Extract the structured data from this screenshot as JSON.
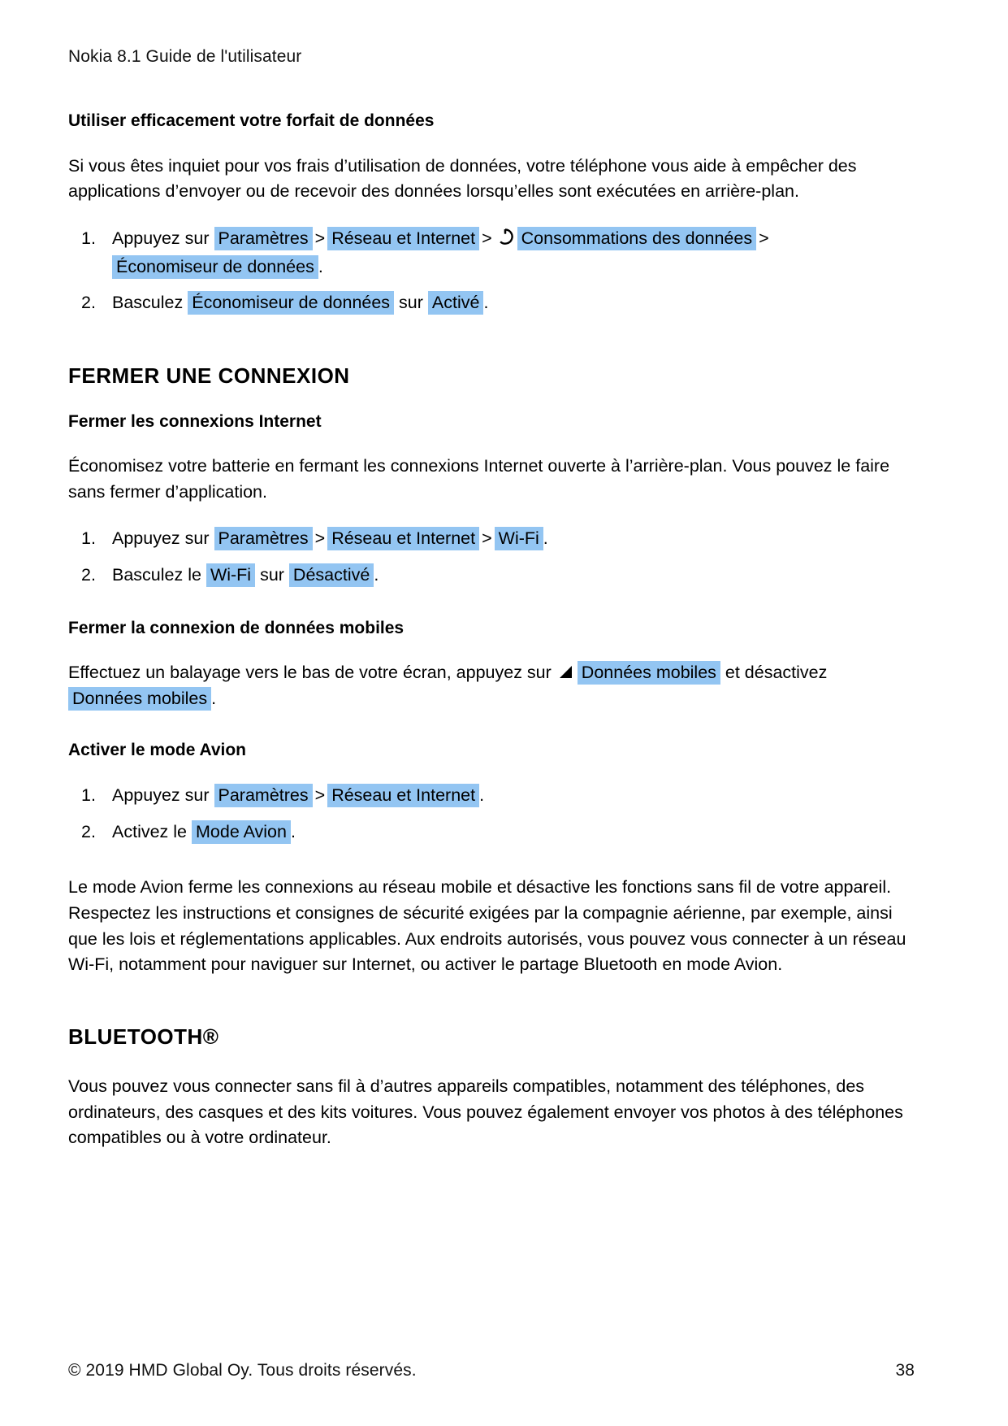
{
  "document": {
    "running_header": "Nokia 8.1 Guide de l'utilisateur",
    "footer": {
      "copyright": "© 2019 HMD Global Oy. Tous droits réservés.",
      "page_number": "38"
    }
  },
  "section_data_saver": {
    "heading": "Utiliser efficacement votre forfait de données",
    "intro": "Si vous êtes inquiet pour vos frais d’utilisation de données, votre téléphone vous aide à empêcher des applications d’envoyer ou de recevoir des données lorsqu’elles sont exécutées en arrière-plan.",
    "step1": {
      "lead": "Appuyez sur",
      "item1": "Paramètres",
      "sep1": ">",
      "item2": "Réseau et Internet",
      "sep2": ">",
      "icon": "data-usage-icon",
      "item3": "Consommations des données",
      "sep3": ">",
      "item4": "Économiseur de données",
      "period": "."
    },
    "step2": {
      "lead": "Basculez",
      "item1": "Économiseur de données",
      "mid": "sur",
      "item2": "Activé",
      "period": "."
    }
  },
  "section_close_connection": {
    "heading": "FERMER UNE CONNEXION",
    "internet": {
      "subheading": "Fermer les connexions Internet",
      "intro": "Économisez votre batterie en fermant les connexions Internet ouverte à l’arrière-plan. Vous pouvez le faire sans fermer d’application.",
      "step1": {
        "lead": "Appuyez sur",
        "item1": "Paramètres",
        "sep1": ">",
        "item2": "Réseau et Internet",
        "sep2": ">",
        "item3": "Wi-Fi",
        "period": "."
      },
      "step2": {
        "lead": "Basculez le",
        "item1": "Wi-Fi",
        "mid": "sur",
        "item2": "Désactivé",
        "period": "."
      }
    },
    "mobile_data": {
      "subheading": "Fermer la connexion de données mobiles",
      "text_before": "Effectuez un balayage vers le bas de votre écran, appuyez sur",
      "icon": "signal-triangle-icon",
      "item1": "Données mobiles",
      "text_middle": "et désactivez",
      "item2": "Données mobiles",
      "period": "."
    },
    "airplane_mode": {
      "subheading": "Activer le mode Avion",
      "step1": {
        "lead": "Appuyez sur",
        "item1": "Paramètres",
        "sep1": ">",
        "item2": "Réseau et Internet",
        "period": "."
      },
      "step2": {
        "lead": "Activez le",
        "item1": "Mode Avion",
        "period": "."
      },
      "note": "Le mode Avion ferme les connexions au réseau mobile et désactive les fonctions sans fil de votre appareil. Respectez les instructions et consignes de sécurité exigées par la compagnie aérienne, par exemple, ainsi que les lois et réglementations applicables. Aux endroits autorisés, vous pouvez vous connecter à un réseau Wi-Fi, notamment pour naviguer sur Internet, ou activer le partage Bluetooth en mode Avion."
    }
  },
  "section_bluetooth": {
    "heading": "BLUETOOTH®",
    "intro": "Vous pouvez vous connecter sans fil à d’autres appareils compatibles, notamment des téléphones, des ordinateurs, des casques et des kits voitures. Vous pouvez également envoyer vos photos à des téléphones compatibles ou à votre ordinateur."
  },
  "colors": {
    "highlight": "#93c5f2",
    "text": "#000000",
    "page_background": "#ffffff"
  }
}
